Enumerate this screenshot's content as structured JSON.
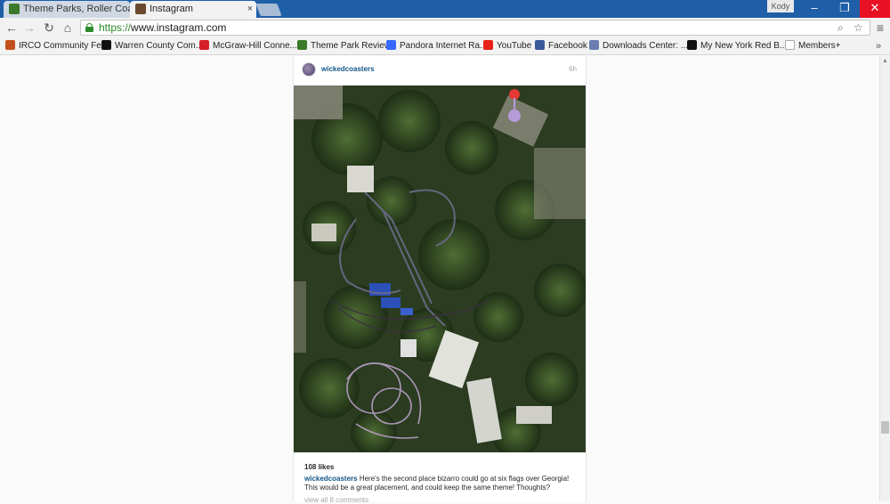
{
  "browser": {
    "tabs": [
      {
        "title": "Theme Parks, Roller Coast",
        "favicon_color": "#3a7a2a",
        "active": false
      },
      {
        "title": "Instagram",
        "favicon_color": "#6b4a2e",
        "active": true
      }
    ],
    "tab_close_glyph": "×",
    "user_badge": "Kody",
    "window_controls": {
      "minimize": "–",
      "maximize": "❐",
      "close": "✕"
    },
    "url": {
      "scheme": "https://",
      "host": "www.instagram.com"
    },
    "nav": {
      "back": "←",
      "forward": "→",
      "reload": "↻",
      "home": "⌂"
    },
    "menu_glyph": "≡",
    "zoom_glyph": "⌕",
    "star_glyph": "☆",
    "bookmarks": [
      {
        "label": "IRCO Community Fe...",
        "icon_color": "#c2501c"
      },
      {
        "label": "Warren County Com...",
        "icon_color": "#111111"
      },
      {
        "label": "McGraw-Hill Conne...",
        "icon_color": "#d62027"
      },
      {
        "label": "Theme Park Review",
        "icon_color": "#3a7a2a"
      },
      {
        "label": "Pandora Internet Ra...",
        "icon_color": "#3668ff"
      },
      {
        "label": "YouTube",
        "icon_color": "#e62117"
      },
      {
        "label": "Facebook",
        "icon_color": "#3b5998"
      },
      {
        "label": "Downloads Center: ...",
        "icon_color": "#6a7fb0"
      },
      {
        "label": "My New York Red B...",
        "icon_color": "#111111"
      },
      {
        "label": "Members+",
        "icon_color": "#bbbbbb"
      }
    ],
    "bookmarks_more": "»"
  },
  "post": {
    "username": "wickedcoasters",
    "time_ago": "6h",
    "likes": "108 likes",
    "caption_user": "wickedcoasters",
    "caption_text": "Here's the second place bizarro could go at six flags over Georgia! This would be a great placement, and could keep the same theme! Thoughts?",
    "view_all": "view all 8 comments"
  },
  "colors": {
    "link_blue": "#125688",
    "close_red": "#e81123",
    "secure_green": "#2a8a2a"
  }
}
